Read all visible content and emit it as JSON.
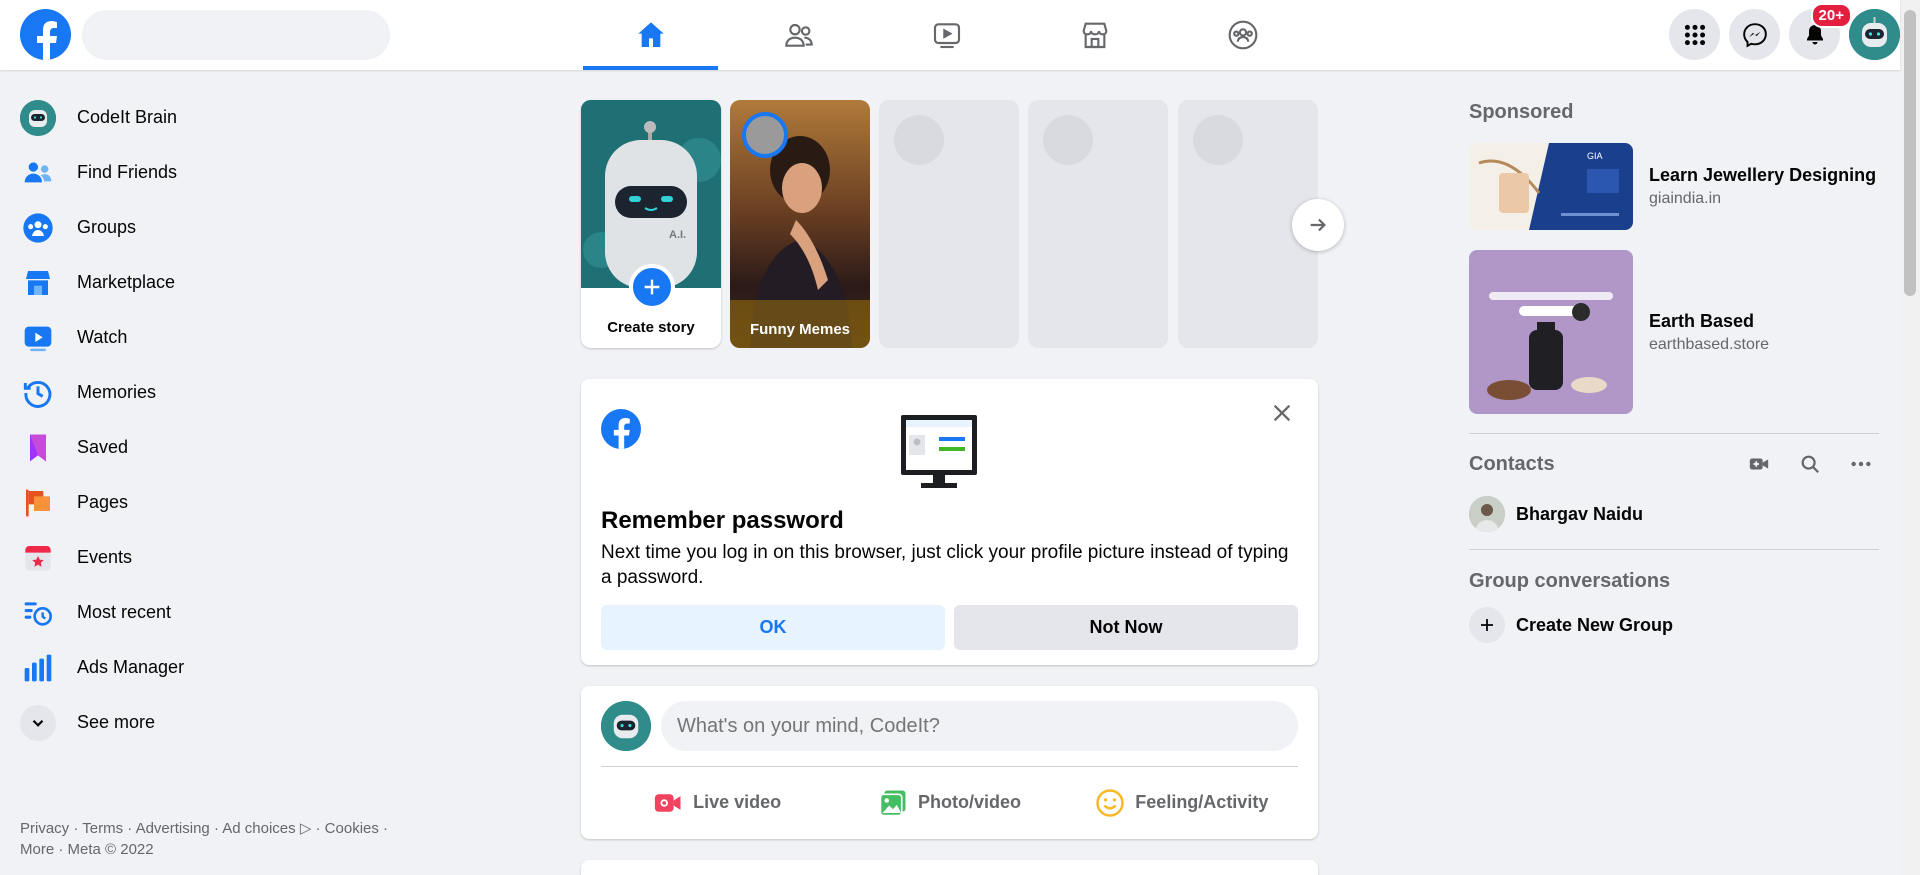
{
  "header": {
    "search_placeholder": "",
    "notification_count": "20+"
  },
  "sidebar": {
    "items": [
      {
        "label": "CodeIt Brain",
        "icon": "profile-avatar"
      },
      {
        "label": "Find Friends",
        "icon": "friends-icon"
      },
      {
        "label": "Groups",
        "icon": "groups-icon"
      },
      {
        "label": "Marketplace",
        "icon": "marketplace-icon"
      },
      {
        "label": "Watch",
        "icon": "watch-icon"
      },
      {
        "label": "Memories",
        "icon": "memories-icon"
      },
      {
        "label": "Saved",
        "icon": "saved-icon"
      },
      {
        "label": "Pages",
        "icon": "pages-icon"
      },
      {
        "label": "Events",
        "icon": "events-icon"
      },
      {
        "label": "Most recent",
        "icon": "most-recent-icon"
      },
      {
        "label": "Ads Manager",
        "icon": "ads-manager-icon"
      },
      {
        "label": "See more",
        "icon": "chevron-down-icon"
      }
    ],
    "footer_line1": "Privacy · Terms · Advertising · Ad choices ▷ · Cookies ·",
    "footer_line2": "More · Meta © 2022"
  },
  "stories": {
    "create_label": "Create story",
    "items": [
      {
        "label": "Funny Memes"
      }
    ]
  },
  "remember_password": {
    "title": "Remember password",
    "description": "Next time you log in on this browser, just click your profile picture instead of typing a password.",
    "ok_label": "OK",
    "not_now_label": "Not Now"
  },
  "composer": {
    "placeholder": "What's on your mind, CodeIt?",
    "actions": [
      {
        "label": "Live video",
        "color": "#f3425f"
      },
      {
        "label": "Photo/video",
        "color": "#45bd62"
      },
      {
        "label": "Feeling/Activity",
        "color": "#f7b928"
      }
    ]
  },
  "right": {
    "sponsored_title": "Sponsored",
    "ads": [
      {
        "name": "Learn Jewellery Designing",
        "site": "giaindia.in"
      },
      {
        "name": "Earth Based",
        "site": "earthbased.store"
      }
    ],
    "contacts_title": "Contacts",
    "contacts": [
      {
        "name": "Bhargav Naidu"
      }
    ],
    "group_title": "Group conversations",
    "create_group_label": "Create New Group"
  },
  "colors": {
    "brand": "#1877f2",
    "background": "#f0f2f5",
    "badge": "#e41e3f"
  }
}
